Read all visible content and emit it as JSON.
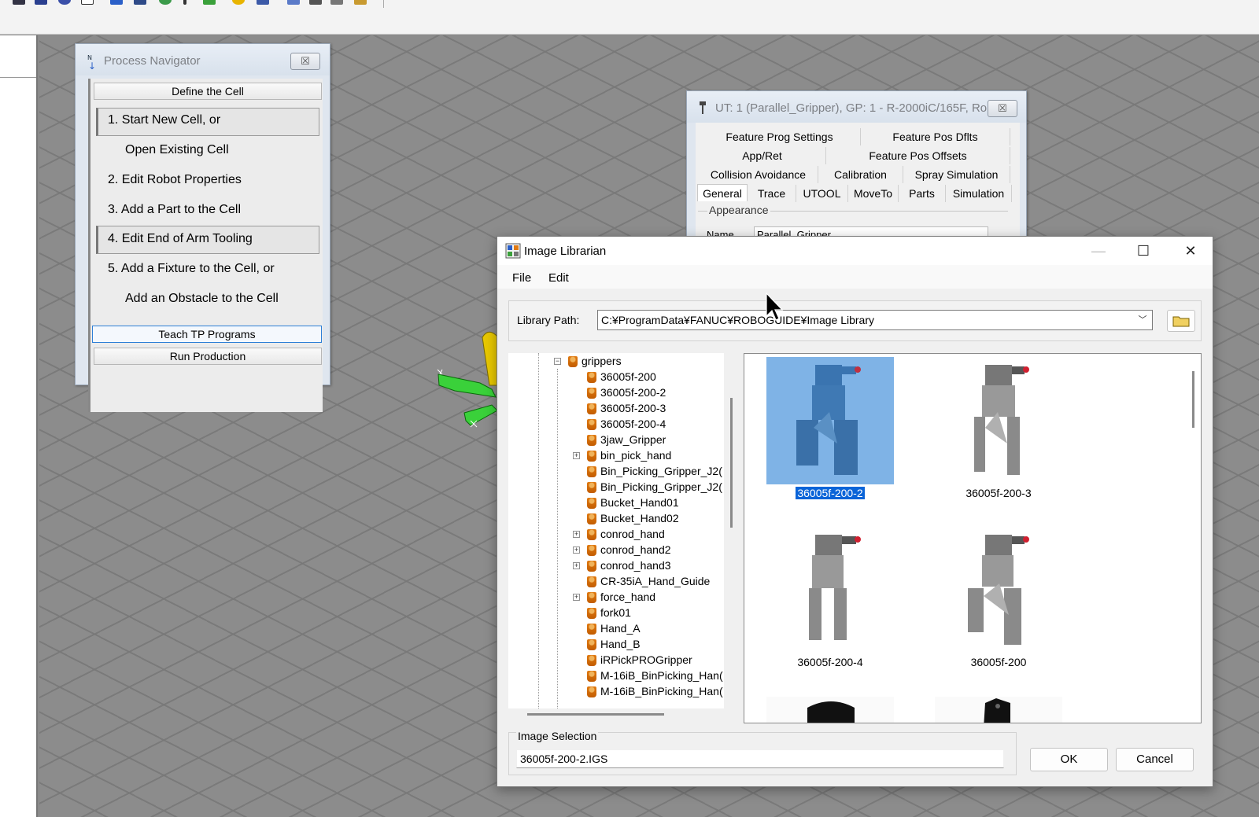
{
  "process_navigator": {
    "title": "Process Navigator",
    "close_icon": "close-icon",
    "define_cell": "Define the Cell",
    "steps": [
      "1.  Start New Cell, or",
      "Open Existing Cell",
      "2.  Edit Robot Properties",
      "3.  Add a Part to the Cell",
      "4.  Edit End of Arm Tooling",
      "5.  Add a Fixture to the Cell, or",
      "Add an Obstacle to the Cell"
    ],
    "teach": "Teach TP Programs",
    "run": "Run Production"
  },
  "ut_dialog": {
    "title": "UT: 1  (Parallel_Gripper), GP: 1 - R-2000iC/165F, Ro...",
    "tabs_row1": [
      "Feature Prog Settings",
      "Feature Pos Dflts"
    ],
    "tabs_row2": [
      "App/Ret",
      "Feature Pos Offsets"
    ],
    "tabs_row3": [
      "Collision Avoidance",
      "Calibration",
      "Spray Simulation"
    ],
    "tabs_row4": [
      "General",
      "Trace",
      "UTOOL",
      "MoveTo",
      "Parts",
      "Simulation"
    ],
    "selected_tab": "General",
    "group_label": "Appearance",
    "name_label": "Name",
    "name_value": "Parallel_Gripper"
  },
  "image_librarian": {
    "title": "Image Librarian",
    "menu": [
      "File",
      "Edit"
    ],
    "library_path_label": "Library Path:",
    "library_path_value": "C:¥ProgramData¥FANUC¥ROBOGUIDE¥Image Library",
    "tree": [
      {
        "label": "grippers",
        "folder": true,
        "expanded": true
      },
      {
        "label": "36005f-200"
      },
      {
        "label": "36005f-200-2"
      },
      {
        "label": "36005f-200-3"
      },
      {
        "label": "36005f-200-4"
      },
      {
        "label": "3jaw_Gripper"
      },
      {
        "label": "bin_pick_hand",
        "folder": true
      },
      {
        "label": "Bin_Picking_Gripper_J2("
      },
      {
        "label": "Bin_Picking_Gripper_J2("
      },
      {
        "label": "Bucket_Hand01"
      },
      {
        "label": "Bucket_Hand02"
      },
      {
        "label": "conrod_hand",
        "folder": true
      },
      {
        "label": "conrod_hand2",
        "folder": true
      },
      {
        "label": "conrod_hand3",
        "folder": true
      },
      {
        "label": "CR-35iA_Hand_Guide"
      },
      {
        "label": "force_hand",
        "folder": true
      },
      {
        "label": "fork01"
      },
      {
        "label": "Hand_A"
      },
      {
        "label": "Hand_B"
      },
      {
        "label": "iRPickPROGripper"
      },
      {
        "label": "M-16iB_BinPicking_Han("
      },
      {
        "label": "M-16iB_BinPicking_Han("
      }
    ],
    "thumbnails": [
      {
        "label": "36005f-200-2",
        "selected": true
      },
      {
        "label": "36005f-200-3"
      },
      {
        "label": "36005f-200-4"
      },
      {
        "label": "36005f-200"
      }
    ],
    "image_selection_label": "Image Selection",
    "image_selection_value": "36005f-200-2.IGS",
    "ok": "OK",
    "cancel": "Cancel"
  },
  "colors": {
    "selection_blue": "#0a64d8",
    "thumb_highlight": "#7fb3e6",
    "robot_green": "#3ad13a",
    "robot_yellow": "#e8c800"
  }
}
